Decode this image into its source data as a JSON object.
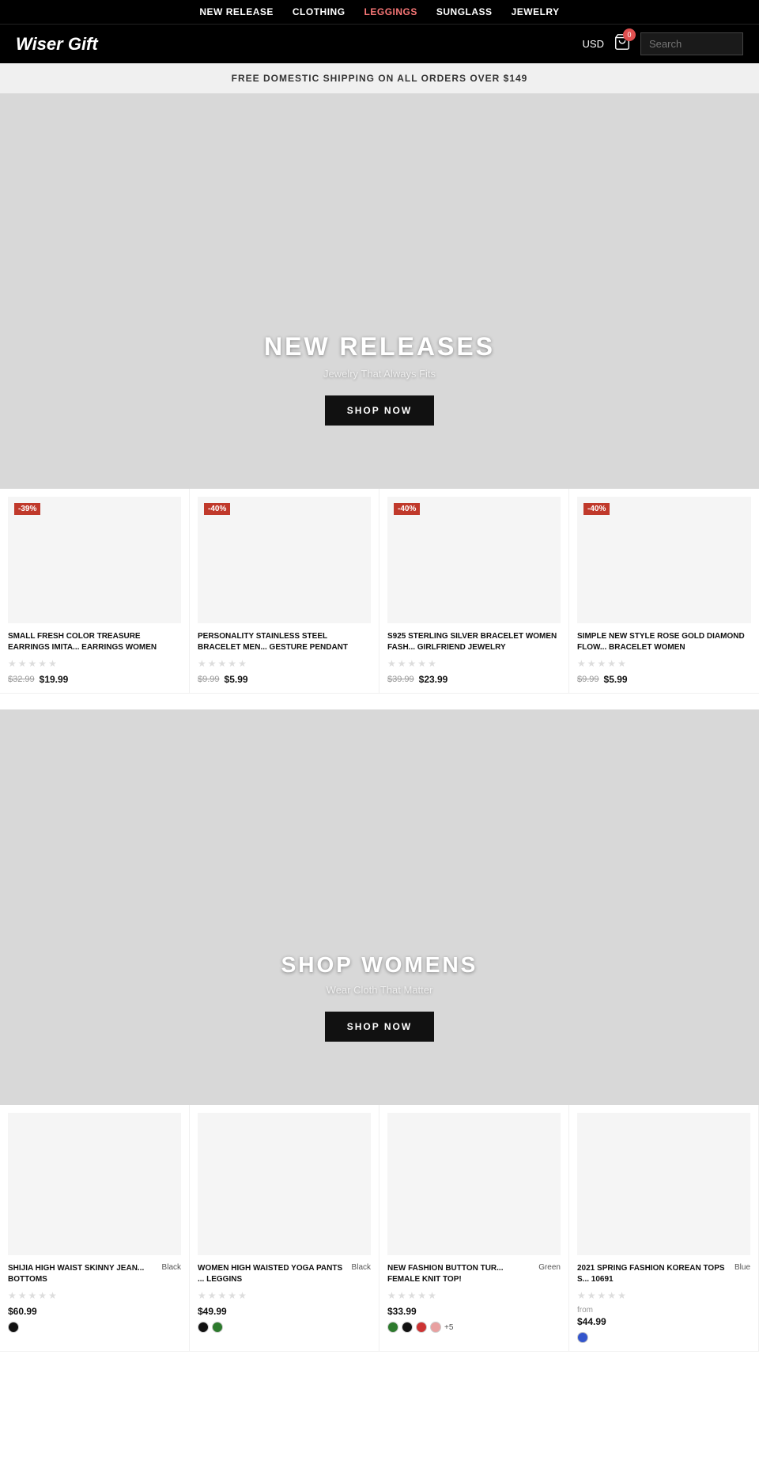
{
  "topNav": {
    "items": [
      {
        "label": "NEW RELEASE",
        "href": "#",
        "highlight": false
      },
      {
        "label": "CLOTHING",
        "href": "#",
        "highlight": false
      },
      {
        "label": "LEGGINGS",
        "href": "#",
        "highlight": true
      },
      {
        "label": "SUNGLASS",
        "href": "#",
        "highlight": false
      },
      {
        "label": "JEWELRY",
        "href": "#",
        "highlight": false
      }
    ]
  },
  "header": {
    "logo": "Wiser Gift",
    "currency": "USD",
    "cart_count": "0",
    "search_placeholder": "Search"
  },
  "banner": {
    "text": "FREE DOMESTIC SHIPPING ON ALL ORDERS OVER $149"
  },
  "hero": {
    "title": "NEW RELEASES",
    "subtitle": "Jewelry That Always Fits",
    "btn": "SHOP NOW"
  },
  "jewelry_products": [
    {
      "title": "SMALL FRESH COLOR TREASURE EARRINGS IMITA... EARRINGS WOMEN",
      "discount": "-39%",
      "original_price": "$32.99",
      "sale_price": "$19.99"
    },
    {
      "title": "PERSONALITY STAINLESS STEEL BRACELET MEN... GESTURE PENDANT",
      "discount": "-40%",
      "original_price": "$9.99",
      "sale_price": "$5.99"
    },
    {
      "title": "S925 STERLING SILVER BRACELET WOMEN FASH... GIRLFRIEND JEWELRY",
      "discount": "-40%",
      "original_price": "$39.99",
      "sale_price": "$23.99"
    },
    {
      "title": "SIMPLE NEW STYLE ROSE GOLD DIAMOND FLOW... BRACELET WOMEN",
      "discount": "-40%",
      "original_price": "$9.99",
      "sale_price": "$5.99"
    }
  ],
  "hero_womens": {
    "title": "SHOP WOMENS",
    "subtitle": "Wear Cloth That Matter",
    "btn": "SHOP NOW"
  },
  "clothing_products": [
    {
      "title": "SHIJIA HIGH WAIST SKINNY JEAN... BOTTOMS",
      "color_label": "Black",
      "price": "$60.99",
      "swatches": [
        "#111111"
      ],
      "extra_colors": null,
      "price_from": false
    },
    {
      "title": "WOMEN HIGH WAISTED YOGA PANTS ... LEGGINS",
      "color_label": "Black",
      "price": "$49.99",
      "swatches": [
        "#111111",
        "#2d7a2d"
      ],
      "extra_colors": null,
      "price_from": false
    },
    {
      "title": "NEW FASHION BUTTON TUR... FEMALE KNIT TOP!",
      "color_label": "Green",
      "price": "$33.99",
      "swatches": [
        "#2d7a2d",
        "#111111",
        "#cc3333",
        "#e8a0a0"
      ],
      "extra_colors": "+5",
      "price_from": false
    },
    {
      "title": "2021 SPRING FASHION KOREAN TOPS S... 10691",
      "color_label": "Blue",
      "price": "$44.99",
      "swatches": [
        "#3355cc"
      ],
      "extra_colors": null,
      "price_from": true
    }
  ]
}
